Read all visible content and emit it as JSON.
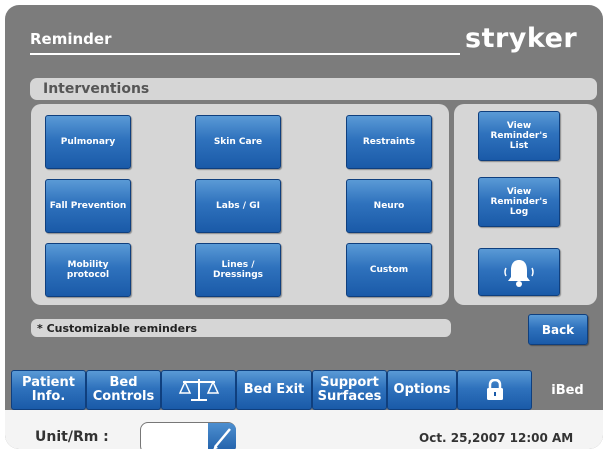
{
  "header": {
    "title": "Reminder",
    "brand": "stryker"
  },
  "section": {
    "label": "Interventions"
  },
  "interventions": [
    "Pulmonary",
    "Skin Care",
    "Restraints",
    "Fall Prevention",
    "Labs / GI",
    "Neuro",
    "Mobility protocol",
    "Lines / Dressings",
    "Custom"
  ],
  "side": {
    "view_list": "View Reminder's List",
    "view_log": "View Reminder's Log",
    "alarm_icon": "bell-icon"
  },
  "footnote": "* Customizable reminders",
  "back_label": "Back",
  "nav": {
    "patient_info": "Patient Info.",
    "bed_controls": "Bed Controls",
    "scale_icon": "scale-icon",
    "bed_exit": "Bed Exit",
    "support_surfaces": "Support Surfaces",
    "options": "Options",
    "lock_icon": "lock-icon",
    "ibed": "iBed"
  },
  "status": {
    "unit_label": "Unit/Rm :",
    "unit_value": "",
    "datetime": "Oct. 25,2007 12:00 AM"
  },
  "colors": {
    "accent": "#2f72bd",
    "panel": "#d6d6d6",
    "frame": "#7c7c7c"
  }
}
